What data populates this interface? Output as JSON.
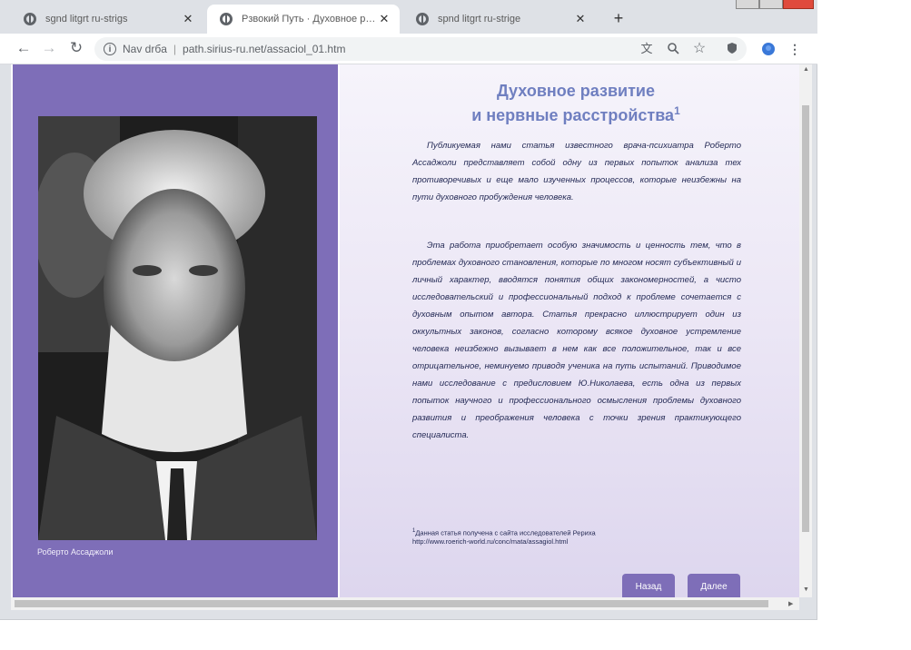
{
  "tabs": [
    {
      "title": "sgnd litgrt ru-strigs"
    },
    {
      "title": "Рзвокий Путь · Духовное разв"
    },
    {
      "title": "spnd litgrt ru-strige"
    }
  ],
  "toolbar": {
    "security_label": "Nav drбa",
    "url": "path.sirius-ru.net/assaciol_01.htm"
  },
  "page": {
    "heading_line1": "Духовное развитие",
    "heading_line2": "и нервные расстройства",
    "heading_sup": "1",
    "paragraph1": "Публикуемая нами статья известного врача-психиатра Роберто Ассаджоли представляет собой одну из первых попыток анализа тех противоречивых и еще мало изученных процессов, которые неизбежны на пути духовного пробуждения человека.",
    "paragraph2": "Эта работа приобретает особую значимость и ценность тем, что в проблемах духовного становления, которые по многом носят субъективный и личный характер, вводятся понятия общих закономерностей, а чисто исследовательский и профессиональный подход к проблеме сочетается с духовным опытом автора. Статья прекрасно иллюстрирует один из оккультных законов, согласно которому всякое духовное устремление человека неизбежно вызывает в нем как все положительное, так и все отрицательное, неминуемо приводя ученика на путь испытаний. Приводимое нами исследование с предисловием Ю.Николаева, есть одна из первых попыток научного и профессионального осмысления проблемы духовного развития и преображения человека с точки зрения практикующего специалиста.",
    "footnote_mark": "1",
    "footnote_line1": "Данная статья получена с сайта исследователей Рериха",
    "footnote_line2": "http://www.roerich-world.ru/conc/mata/assagiol.html",
    "photo_caption": "Роберто Ассаджоли",
    "btn_back": "Назад",
    "btn_next": "Далее"
  },
  "icons": {
    "back": "arrow-left-icon",
    "forward": "arrow-right-icon",
    "reload": "reload-icon",
    "translate": "translate-icon",
    "zoom": "zoom-icon",
    "star": "bookmark-star-icon",
    "extension": "extension-icon",
    "profile": "profile-icon",
    "menu": "kebab-menu-icon"
  },
  "colors": {
    "left_panel": "#7e6eb8",
    "heading": "#6f7fc0",
    "body_text": "#242a55"
  }
}
